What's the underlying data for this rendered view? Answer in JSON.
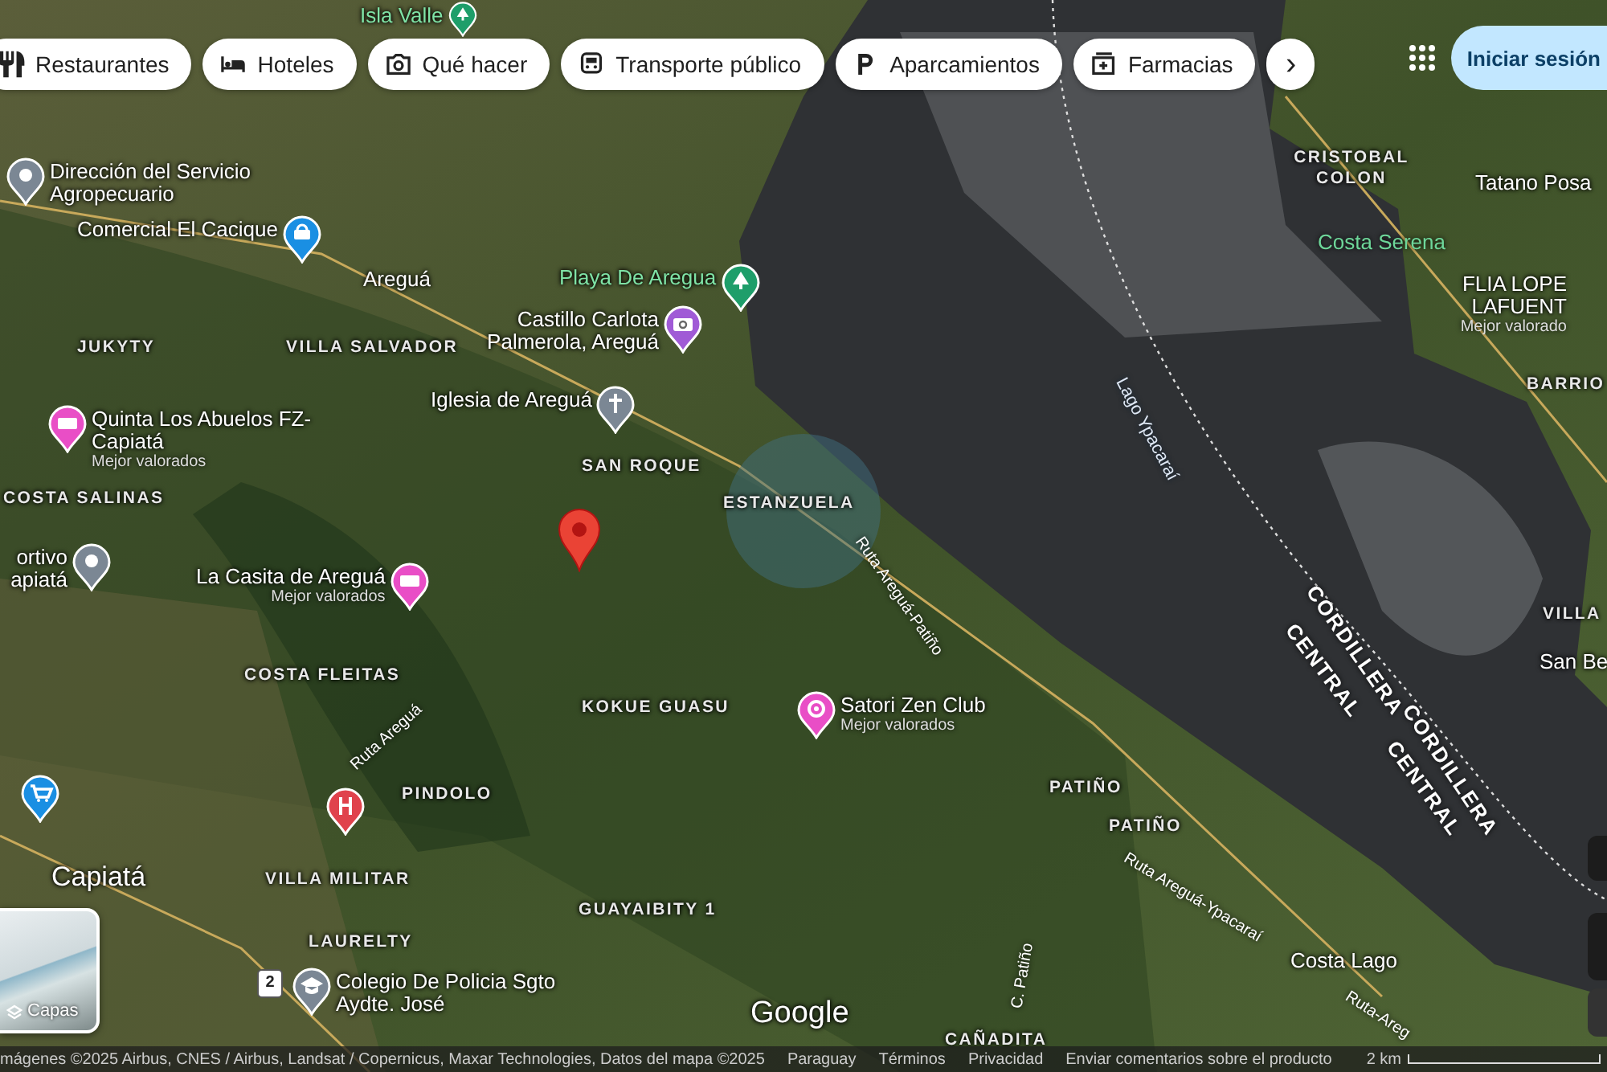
{
  "top_bar": {
    "chips": [
      {
        "label": "Restaurantes",
        "kind": "food"
      },
      {
        "label": "Hoteles",
        "kind": "lodging"
      },
      {
        "label": "Qué hacer",
        "kind": "activity"
      },
      {
        "label": "Transporte público",
        "kind": "transit"
      },
      {
        "label": "Aparcamientos",
        "kind": "parking"
      },
      {
        "label": "Farmacias",
        "kind": "pharmacy"
      }
    ],
    "next_button": "›",
    "sign_in": "Iniciar sesión"
  },
  "map": {
    "places": [
      {
        "text": "Areguá",
        "kind": "town"
      },
      {
        "text": "JUKYTY",
        "kind": "locality"
      },
      {
        "text": "VILLA SALVADOR",
        "kind": "locality"
      },
      {
        "text": "SAN ROQUE",
        "kind": "locality"
      },
      {
        "text": "ESTANZUELA",
        "kind": "locality"
      },
      {
        "text": "COSTA SALINAS",
        "kind": "locality"
      },
      {
        "text": "COSTA FLEITAS",
        "kind": "locality"
      },
      {
        "text": "KOKUE GUASU",
        "kind": "locality"
      },
      {
        "text": "PINDOLO",
        "kind": "locality"
      },
      {
        "text": "VILLA MILITAR",
        "kind": "locality"
      },
      {
        "text": "LAURELTY",
        "kind": "locality"
      },
      {
        "text": "GUAYAIBITY 1",
        "kind": "locality"
      },
      {
        "text": "PATIÑO",
        "kind": "locality"
      },
      {
        "text": "PATIÑO",
        "kind": "locality"
      },
      {
        "text": "CAÑADITA",
        "kind": "locality"
      },
      {
        "text": "CRISTOBAL COLON",
        "kind": "locality"
      },
      {
        "text": "BARRIO",
        "kind": "locality"
      },
      {
        "text": "VILLA",
        "kind": "locality"
      },
      {
        "text": "Capiatá",
        "kind": "city"
      },
      {
        "text": "Costa Lago",
        "kind": "town"
      },
      {
        "text": "Tatano Posa",
        "kind": "town"
      },
      {
        "text": "San Be",
        "kind": "town"
      },
      {
        "text": "Costa Serena",
        "kind": "park"
      },
      {
        "text": "Lago Ypacaraí",
        "kind": "water"
      },
      {
        "text": "CORDILLERA",
        "kind": "range"
      },
      {
        "text": "CENTRAL",
        "kind": "range"
      },
      {
        "text": "CORDILLERA",
        "kind": "range"
      },
      {
        "text": "CENTRAL",
        "kind": "range"
      },
      {
        "text": "Ruta Areguá-Patiño",
        "kind": "road"
      },
      {
        "text": "Ruta Areguá",
        "kind": "road"
      },
      {
        "text": "Ruta Areguá-Ypacaraí",
        "kind": "road"
      },
      {
        "text": "C. Patiño",
        "kind": "road"
      },
      {
        "text": "Ruta-Areg",
        "kind": "road"
      }
    ],
    "pois": [
      {
        "name": "Dirección del Servicio Agropecuario",
        "kind": "place",
        "color": "#7b8794"
      },
      {
        "name": "Comercial El Cacique",
        "kind": "shop",
        "color": "#1a8fe3"
      },
      {
        "name": "Playa De Aregua",
        "kind": "park",
        "color": "#1e9e6a"
      },
      {
        "name": "Castillo Carlota Palmerola, Areguá",
        "kind": "sight",
        "color": "#a05ad6"
      },
      {
        "name": "Iglesia de Areguá",
        "kind": "church",
        "color": "#7b8794"
      },
      {
        "name": "Quinta Los Abuelos FZ-Capiatá",
        "subtitle": "Mejor valorados",
        "kind": "lodging",
        "color": "#e94ec6"
      },
      {
        "name": "ortivo apiatá",
        "kind": "place",
        "color": "#7b8794"
      },
      {
        "name": "La Casita de Areguá",
        "subtitle": "Mejor valorados",
        "kind": "lodging",
        "color": "#e94ec6"
      },
      {
        "name": "Satori Zen Club",
        "subtitle": "Mejor valorados",
        "kind": "wellness",
        "color": "#e94ec6"
      },
      {
        "name": "Isla Valle",
        "kind": "park",
        "color": "#1e9e6a"
      },
      {
        "name": "FLIA LOPE LAFUENT",
        "subtitle": "Mejor valorado",
        "kind": "label"
      },
      {
        "name": "Colegio De Policia Sgto Aydte. José",
        "kind": "school",
        "color": "#7b8794"
      },
      {
        "kind": "market",
        "color": "#1a8fe3"
      },
      {
        "kind": "hospital",
        "color": "#e0424c"
      }
    ],
    "route_shield": "2"
  },
  "layers": {
    "label": "Capas"
  },
  "logo": "Google",
  "footer": {
    "attribution": "mágenes ©2025 Airbus, CNES / Airbus, Landsat / Copernicus, Maxar Technologies, Datos del mapa ©2025",
    "links": [
      "Paraguay",
      "Términos",
      "Privacidad",
      "Enviar comentarios sobre el producto"
    ],
    "scale": "2 km"
  }
}
